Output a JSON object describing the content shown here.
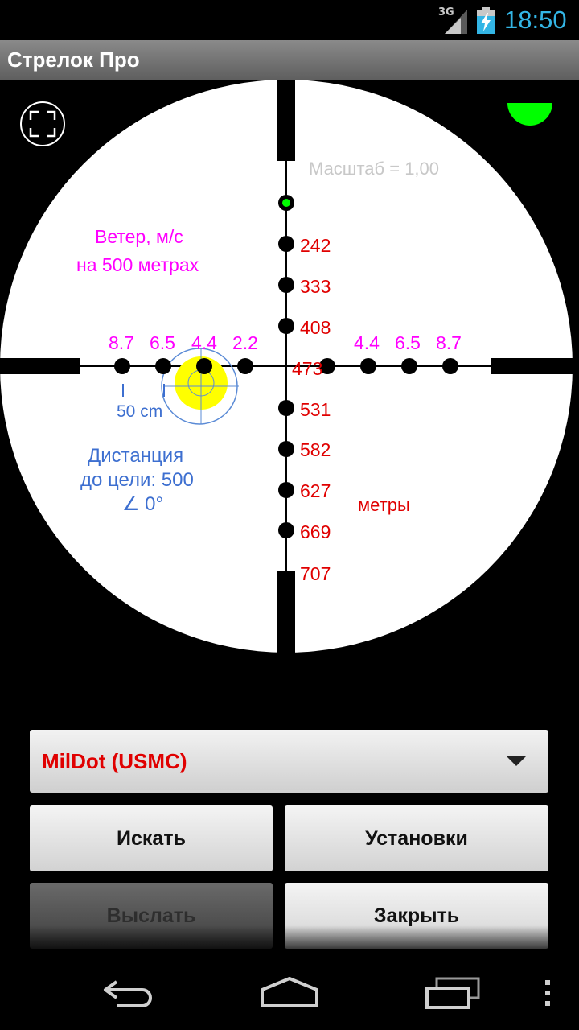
{
  "status_bar": {
    "network": "3G",
    "time": "18:50"
  },
  "app": {
    "title": "Стрелок Про"
  },
  "scope": {
    "scale_label": "Масштаб = 1,00",
    "wind_title": "Ветер, м/с",
    "wind_distance": "на 500 метрах",
    "wind_left": [
      "8.7",
      "6.5",
      "4.4",
      "2.2"
    ],
    "wind_right": [
      "4.4",
      "6.5",
      "8.7"
    ],
    "ranges": [
      "242",
      "333",
      "408",
      "473",
      "531",
      "582",
      "627",
      "669",
      "707"
    ],
    "group_size": "50 cm",
    "distance_line1": "Дистанция",
    "distance_line2": "до цели: 500",
    "angle": "∠  0°",
    "units": "метры",
    "colors": {
      "wind": "#ff00ff",
      "range": "#e00000",
      "distance": "#3d6fd0",
      "target": "#ffff00",
      "status": "#00ff00"
    }
  },
  "reticle_select": {
    "value": "MilDot (USMC)"
  },
  "buttons": {
    "search": "Искать",
    "settings": "Установки",
    "send": "Выслать",
    "close": "Закрыть"
  }
}
